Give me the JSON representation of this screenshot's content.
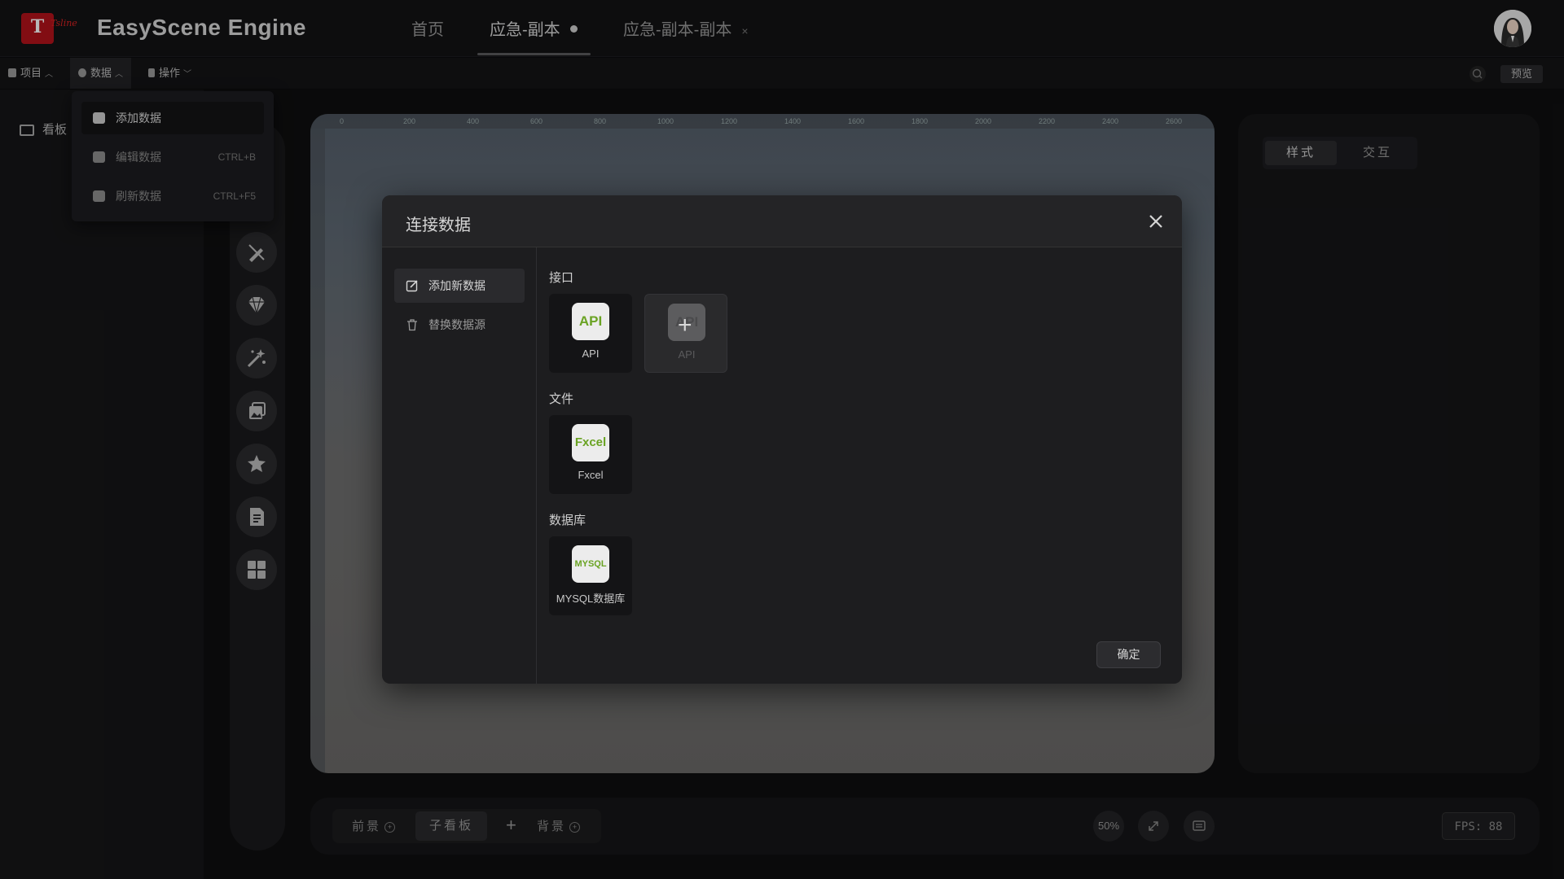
{
  "app": {
    "logo_letter": "T",
    "logo_text": "Tsline",
    "title": "EasyScene Engine"
  },
  "tabs": [
    {
      "label": "首页"
    },
    {
      "label": "应急-副本"
    },
    {
      "label": "应急-副本-副本",
      "close": "×"
    }
  ],
  "menubar": {
    "project": "项目",
    "data": "数据",
    "operation": "操作",
    "preview": "预览"
  },
  "data_menu": [
    {
      "label": "添加数据",
      "shortcut": ""
    },
    {
      "label": "编辑数据",
      "shortcut": "CTRL+B"
    },
    {
      "label": "刷新数据",
      "shortcut": "CTRL+F5"
    }
  ],
  "left_panel": {
    "board_label": "看板"
  },
  "ruler": {
    "ticks": [
      "0",
      "200",
      "400",
      "600",
      "800",
      "1000",
      "1200",
      "1400",
      "1600",
      "1800",
      "2000",
      "2200",
      "2400",
      "2600"
    ]
  },
  "right_panel": {
    "style_tab": "样式",
    "interact_tab": "交互"
  },
  "bottom": {
    "foreground": "前景",
    "sub_board": "子看板",
    "background": "背景",
    "zoom": "50%",
    "fps": "FPS: 88"
  },
  "modal": {
    "title": "连接数据",
    "side": [
      {
        "label": "添加新数据"
      },
      {
        "label": "替换数据源"
      }
    ],
    "sections": {
      "interface": "接口",
      "file": "文件",
      "database": "数据库"
    },
    "cards": {
      "api": {
        "icon": "API",
        "label": "API"
      },
      "api_add": {
        "icon": "API",
        "label": "API"
      },
      "excel": {
        "icon": "Fxcel",
        "label": "Fxcel"
      },
      "mysql": {
        "icon": "MYSQL",
        "label": "MYSQL数据库"
      }
    },
    "ok": "确定"
  },
  "colors": {
    "accent_green": "#6aa323",
    "brand_red": "#b5121b"
  }
}
